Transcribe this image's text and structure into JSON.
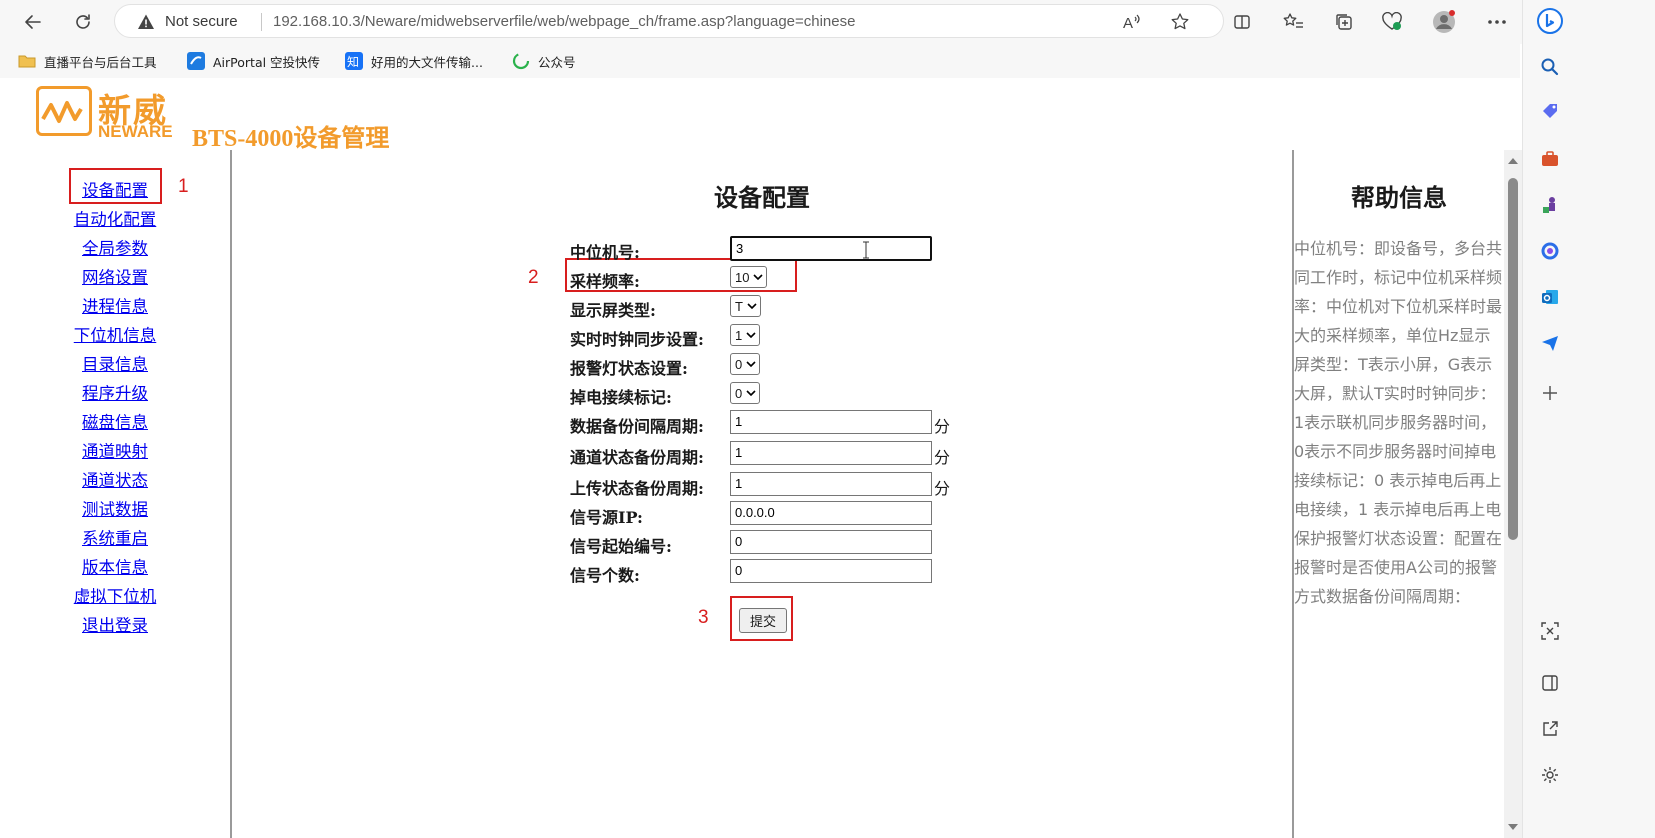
{
  "browser": {
    "security_label": "Not secure",
    "url": "192.168.10.3/Neware/midwebserverfile/web/webpage_ch/frame.asp?language=chinese",
    "bookmarks": [
      {
        "label": "直播平台与后台工具",
        "icon": "folder-icon"
      },
      {
        "label": "AirPortal 空投快传",
        "icon": "airportal-icon"
      },
      {
        "label": "好用的大文件传输...",
        "icon": "zhi-icon"
      },
      {
        "label": "公众号",
        "icon": "wechat-icon"
      }
    ],
    "colors": {
      "toolbar_bg": "#f7f7f7",
      "edge_blue": "#1a73e8"
    }
  },
  "logo": {
    "brand_cn": "新威",
    "brand_en": "NEWARE",
    "title": "BTS-4000设备管理",
    "color": "#f29b2c"
  },
  "nav": {
    "items": [
      "设备配置",
      "自动化配置",
      "全局参数",
      "网络设置",
      "进程信息",
      "下位机信息",
      "目录信息",
      "程序升级",
      "磁盘信息",
      "通道映射",
      "通道状态",
      "测试数据",
      "系统重启",
      "版本信息",
      "虚拟下位机",
      "退出登录"
    ],
    "annotation": "1"
  },
  "form": {
    "title": "设备配置",
    "fields": [
      {
        "label": "中位机号:",
        "type": "text",
        "value": "3",
        "unit": ""
      },
      {
        "label": "采样频率:",
        "type": "select",
        "value": "10",
        "unit": ""
      },
      {
        "label": "显示屏类型:",
        "type": "select",
        "value": "T",
        "unit": ""
      },
      {
        "label": "实时时钟同步设置:",
        "type": "select",
        "value": "1",
        "unit": ""
      },
      {
        "label": "报警灯状态设置:",
        "type": "select",
        "value": "0",
        "unit": ""
      },
      {
        "label": "掉电接续标记:",
        "type": "select",
        "value": "0",
        "unit": ""
      },
      {
        "label": "数据备份间隔周期:",
        "type": "text",
        "value": "1",
        "unit": "分"
      },
      {
        "label": "通道状态备份周期:",
        "type": "text",
        "value": "1",
        "unit": "分"
      },
      {
        "label": "上传状态备份周期:",
        "type": "text",
        "value": "1",
        "unit": "分"
      },
      {
        "label": "信号源IP:",
        "type": "text",
        "value": "0.0.0.0",
        "unit": ""
      },
      {
        "label": "信号起始编号:",
        "type": "text",
        "value": "0",
        "unit": ""
      },
      {
        "label": "信号个数:",
        "type": "text",
        "value": "0",
        "unit": ""
      }
    ],
    "submit_label": "提交",
    "annotation_2": "2",
    "annotation_3": "3",
    "annotation_color": "#d81e1e"
  },
  "help": {
    "title": "帮助信息",
    "text": "中位机号：即设备号，多台共同工作时，标记中位机采样频率：中位机对下位机采样时最大的采样频率，单位Hz显示屏类型：T表示小屏，G表示大屏，默认T实时时钟同步：1表示联机同步服务器时间，0表示不同步服务器时间掉电接续标记：0 表示掉电后再上电接续，1 表示掉电后再上电保护报警灯状态设置：配置在报警时是否使用A公司的报警方式数据备份间隔周期："
  }
}
